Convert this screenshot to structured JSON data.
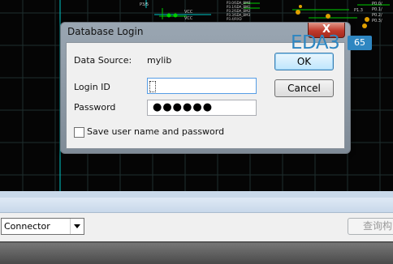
{
  "schematic": {
    "labels": [
      "P3/5",
      "VCC",
      "VCC",
      "P3.0/SDA_BM0",
      "P3.1/SDA_BM1",
      "P3.2/SDA_BM2",
      "P3.3/SDA_BM3",
      "P3.4/RXD",
      "P0.0/",
      "P0.1/",
      "P0.2/",
      "P0.3/",
      "P1.3"
    ]
  },
  "dialog": {
    "title": "Database Login",
    "close_label": "X",
    "data_source_label": "Data Source:",
    "data_source_value": "mylib",
    "login_id_label": "Login ID",
    "login_id_value": "",
    "password_label": "Password",
    "password_value": "●●●●●●",
    "save_checkbox_label": "Save user name and password",
    "ok_label": "OK",
    "cancel_label": "Cancel"
  },
  "watermark": {
    "text": "EDA3",
    "suffix": "65"
  },
  "bottom_panel": {
    "select_value": "Connector",
    "query_button_label": "查询构"
  },
  "colors": {
    "grid_line": "#1c3b3b",
    "wire": "#00c8c8",
    "accent_blue": "#2e86c1",
    "close_red": "#c0392b"
  }
}
